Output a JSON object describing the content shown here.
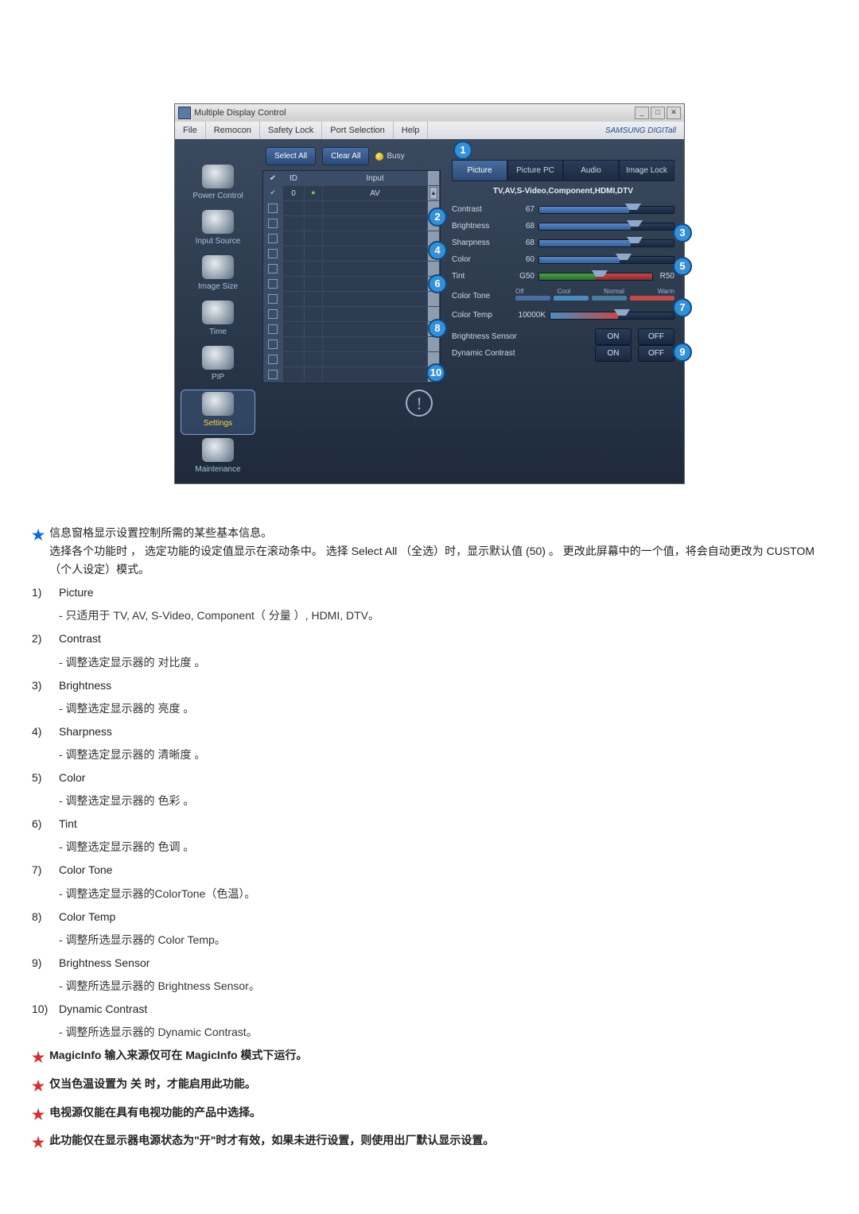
{
  "window": {
    "title": "Multiple Display Control"
  },
  "menu": {
    "file": "File",
    "remocon": "Remocon",
    "safety": "Safety Lock",
    "port": "Port Selection",
    "help": "Help",
    "brand": "SAMSUNG DIGITall"
  },
  "sidebar": {
    "items": [
      {
        "label": "Power Control"
      },
      {
        "label": "Input Source"
      },
      {
        "label": "Image Size"
      },
      {
        "label": "Time"
      },
      {
        "label": "PIP"
      },
      {
        "label": "Settings"
      },
      {
        "label": "Maintenance"
      }
    ]
  },
  "tops": {
    "select": "Select All",
    "clear": "Clear All",
    "busy": "Busy"
  },
  "grid": {
    "h_id": "ID",
    "h_input": "Input",
    "row_id": "0",
    "row_input": "AV"
  },
  "tabs": {
    "picture": "Picture",
    "pc": "Picture PC",
    "audio": "Audio",
    "lock": "Image Lock"
  },
  "subh": "TV,AV,S-Video,Component,HDMI,DTV",
  "rows": {
    "contrast": {
      "label": "Contrast",
      "val": "67"
    },
    "brightness": {
      "label": "Brightness",
      "val": "68"
    },
    "sharpness": {
      "label": "Sharpness",
      "val": "68"
    },
    "color": {
      "label": "Color",
      "val": "60"
    },
    "tint": {
      "label": "Tint",
      "val": "G50",
      "valR": "R50"
    },
    "tone": {
      "label": "Color Tone",
      "off": "Off",
      "cool": "Cool",
      "normal": "Normal",
      "warm": "Warm"
    },
    "temp": {
      "label": "Color Temp",
      "val": "10000K"
    },
    "sensor": {
      "label": "Brightness Sensor"
    },
    "dyn": {
      "label": "Dynamic Contrast"
    }
  },
  "onoff": {
    "on": "ON",
    "off": "OFF"
  },
  "callouts": {
    "1": "1",
    "2": "2",
    "3": "3",
    "4": "4",
    "5": "5",
    "6": "6",
    "7": "7",
    "8": "8",
    "9": "9",
    "10": "10"
  },
  "doc": {
    "intro1": "信息窗格显示设置控制所需的某些基本信息。",
    "intro2": "选择各个功能时 ，  选定功能的设定值显示在滚动条中。 选择 Select All （全选）时，显示默认值 (50) 。  更改此屏幕中的一个值，将会自动更改为 CUSTOM（个人设定）模式。",
    "items": [
      {
        "n": "1)",
        "t": "Picture",
        "s": "- 只适用于 TV, AV, S-Video, Component（ 分量 ）, HDMI, DTV。"
      },
      {
        "n": "2)",
        "t": "Contrast",
        "s": "- 调整选定显示器的 对比度 。"
      },
      {
        "n": "3)",
        "t": "Brightness",
        "s": "- 调整选定显示器的 亮度 。"
      },
      {
        "n": "4)",
        "t": "Sharpness",
        "s": "- 调整选定显示器的 清晰度 。"
      },
      {
        "n": "5)",
        "t": "Color",
        "s": "- 调整选定显示器的 色彩 。"
      },
      {
        "n": "6)",
        "t": "Tint",
        "s": "- 调整选定显示器的 色调 。"
      },
      {
        "n": "7)",
        "t": "Color Tone",
        "s": "- 调整选定显示器的ColorTone（色温）。"
      },
      {
        "n": "8)",
        "t": "Color Temp",
        "s": "- 调整所选显示器的 Color Temp。"
      },
      {
        "n": "9)",
        "t": "Brightness Sensor",
        "s": "- 调整所选显示器的 Brightness Sensor。"
      },
      {
        "n": "10)",
        "t": "Dynamic Contrast",
        "s": "- 调整所选显示器的 Dynamic Contrast。"
      }
    ],
    "starNotes": [
      "MagicInfo 输入来源仅可在 MagicInfo 模式下运行。",
      "仅当色温设置为 关 时，才能启用此功能。",
      "电视源仅能在具有电视功能的产品中选择。",
      "此功能仅在显示器电源状态为\"开\"时才有效，如果未进行设置，则使用出厂默认显示设置。"
    ]
  }
}
